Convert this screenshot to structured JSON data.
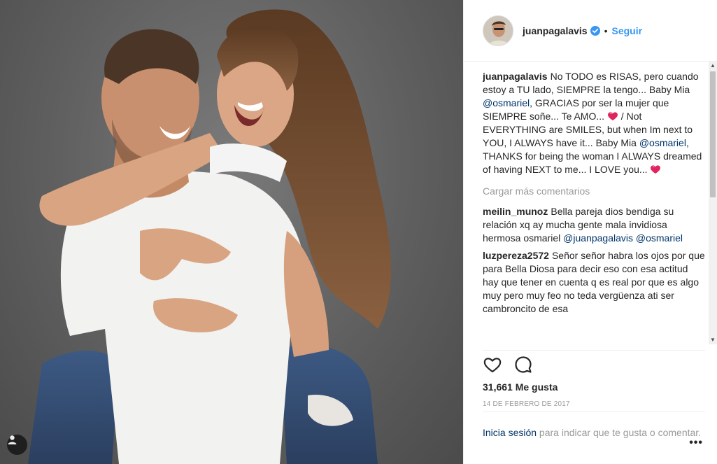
{
  "post": {
    "username": "juanpagalavis",
    "separator": "•",
    "follow_label": "Seguir",
    "caption": {
      "user": "juanpagalavis",
      "part1": "No TODO es RISAS, pero cuando estoy a TU lado, SIEMPRE la tengo... Baby Mia",
      "mention1": "@osmariel",
      "part2": ", GRACIAS por ser la mujer que SIEMPRE soñe... Te AMO...",
      "part3": " / Not EVERYTHING are SMILES, but when Im next to YOU, I ALWAYS have it... Baby Mia",
      "mention2": "@osmariel",
      "part4": ", THANKS for being the woman I ALWAYS dreamed of having NEXT to me... I LOVE you...",
      "heart_icon": "red-heart-emoji"
    },
    "load_more_label": "Cargar más comentarios",
    "comments": [
      {
        "user": "meilin_munoz",
        "text": "Bella pareja dios bendiga su relación xq ay mucha gente mala invidiosa hermosa osmariel",
        "mention1": "@juanpagalavis",
        "mention2": "@osmariel"
      },
      {
        "user": "luzpereza2572",
        "text": "Señor señor habra los ojos por que para Bella Diosa para decir eso con esa actitud hay que tener en cuenta q es real por que es algo muy pero muy feo no teda vergüenza ati ser cambroncito de esa"
      }
    ],
    "likes": "31,661 Me gusta",
    "date": "14 DE FEBRERO DE 2017",
    "login_link": "Inicia sesión",
    "login_text": " para indicar que te gusta o comentar.",
    "more_label": "•••",
    "icons": {
      "like": "heart-outline-icon",
      "comment": "comment-bubble-icon",
      "verified": "verified-badge-icon",
      "user_tag": "user-tag-icon"
    }
  },
  "colors": {
    "link_blue": "#3897f0",
    "mention_blue": "#003569",
    "muted": "#999999",
    "text": "#262626"
  }
}
